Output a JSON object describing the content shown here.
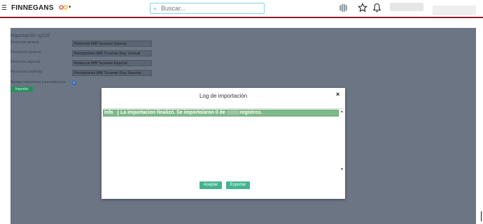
{
  "header": {
    "brand": "FINNEGANS",
    "caret": "▾",
    "search_placeholder": "Buscar...",
    "icons": [
      "menu-icon",
      "brand-logo-icon",
      "search-icon",
      "cube-icon",
      "star-icon",
      "bell-icon"
    ]
  },
  "form": {
    "title": "Importación rg116",
    "fields": [
      {
        "label": "Retencion general",
        "value": "Retencion IIBB Tucuman General"
      },
      {
        "label": "Percepcion general",
        "value": "Percepciones IIBB Tucuman Reg. General"
      },
      {
        "label": "Retencion especial",
        "value": "Retencion IIBB Tucuman Especial"
      },
      {
        "label": "Percepcion especial",
        "value": "Percepciones IIBB Tucuman Reg. Especial"
      }
    ],
    "checkbox_label": "Agrega retenciones y percepciones",
    "checkbox_checked": true,
    "button": "Importar"
  },
  "modal": {
    "title": "Log de importación",
    "close": "×",
    "log": [
      {
        "level": "Info",
        "message_before": "La importacion finalizó. Se importo/aron 0 de",
        "message_after": "registros."
      }
    ],
    "accept": "Aceptar",
    "export": "Exportar"
  },
  "colors": {
    "accent_bar": "#8b1e2c",
    "overlay": "#6b7584",
    "log_row": "#7fbb8a",
    "button": "#44b48c"
  }
}
